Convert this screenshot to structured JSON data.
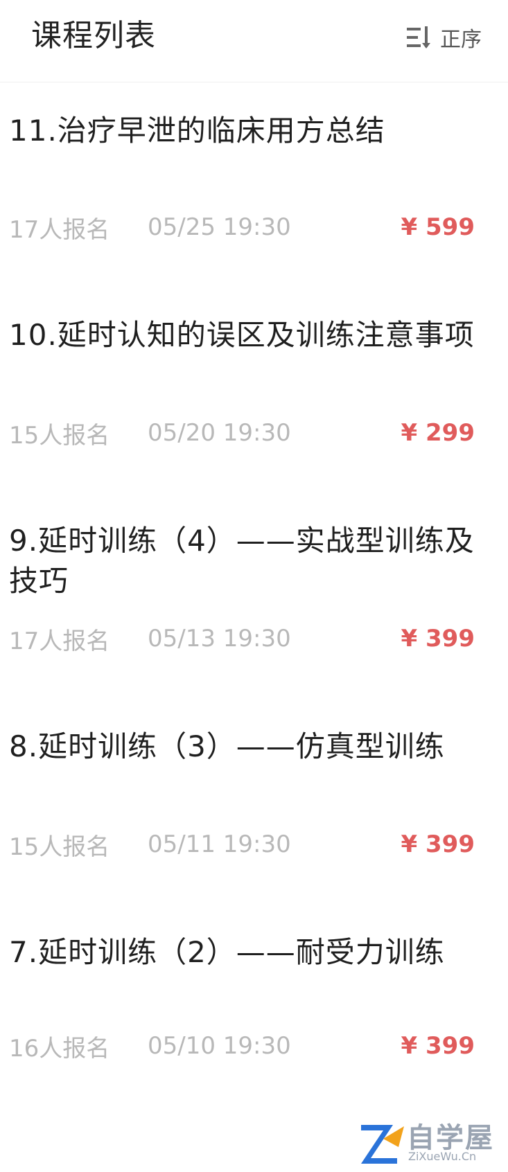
{
  "header": {
    "title": "课程列表",
    "sort_label": "正序",
    "sort_icon": "sort-icon"
  },
  "colors": {
    "price": "#e05b5b",
    "meta": "#b8b8b8",
    "title": "#1f1f1f"
  },
  "courses": [
    {
      "title": "11.治疗早泄的临床用方总结",
      "enroll": "17人报名",
      "time": "05/25 19:30",
      "price": "¥ 599"
    },
    {
      "title": "10.延时认知的误区及训练注意事项",
      "enroll": "15人报名",
      "time": "05/20 19:30",
      "price": "¥ 299"
    },
    {
      "title": "9.延时训练（4）——实战型训练及技巧",
      "enroll": "17人报名",
      "time": "05/13 19:30",
      "price": "¥ 399"
    },
    {
      "title": "8.延时训练（3）——仿真型训练",
      "enroll": "15人报名",
      "time": "05/11 19:30",
      "price": "¥ 399"
    },
    {
      "title": "7.延时训练（2）——耐受力训练",
      "enroll": "16人报名",
      "time": "05/10 19:30",
      "price": "¥ 399"
    }
  ],
  "watermark": {
    "text": "自学屋",
    "sub": "ZiXueWu.Cn"
  }
}
